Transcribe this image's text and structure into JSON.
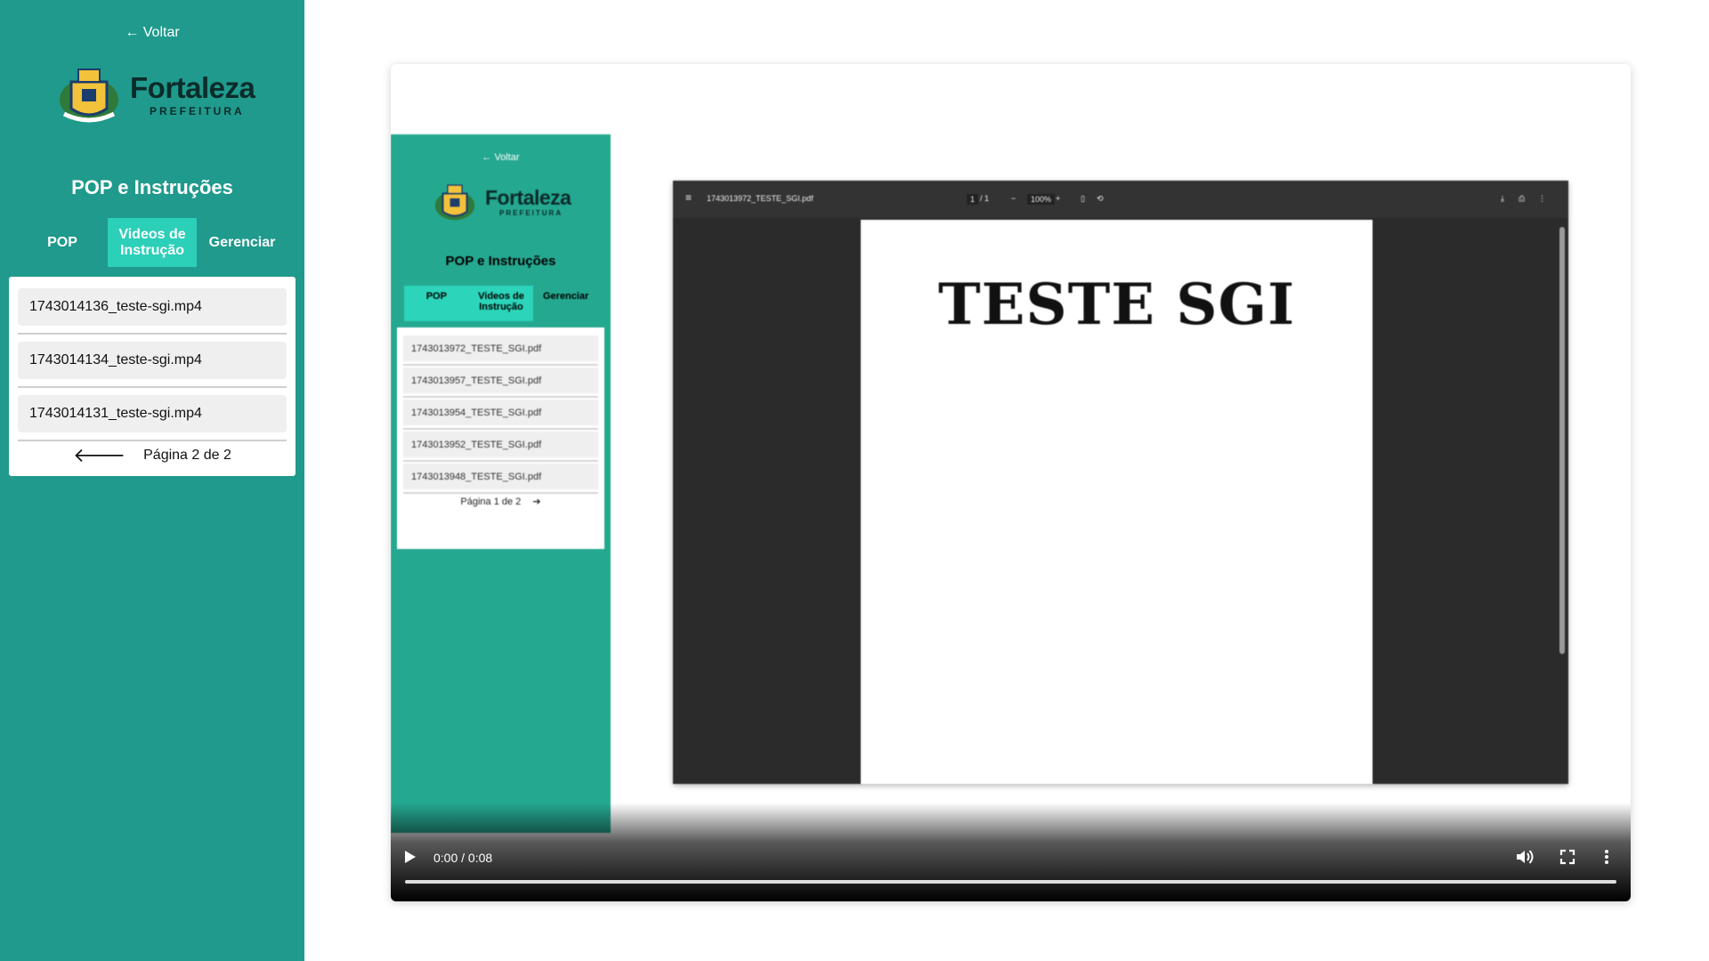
{
  "sidebar": {
    "back_label": "← Voltar",
    "logo_name": "Fortaleza",
    "logo_sub": "PREFEITURA",
    "title": "POP e Instruções",
    "tabs": [
      {
        "label": "POP",
        "active": false
      },
      {
        "label": "Videos de Instrução",
        "active": true
      },
      {
        "label": "Gerenciar",
        "active": false
      }
    ],
    "files": [
      "1743014136_teste-sgi.mp4",
      "1743014134_teste-sgi.mp4",
      "1743014131_teste-sgi.mp4"
    ],
    "pager_prev_icon": "arrow-left-icon",
    "pager_label": "Página 2 de 2"
  },
  "video": {
    "time_label": "0:00 / 0:08",
    "icons": [
      "play-icon",
      "volume-icon",
      "fullscreen-icon",
      "more-options-icon"
    ],
    "frame": {
      "back_label": "← Voltar",
      "logo_name": "Fortaleza",
      "logo_sub": "PREFEITURA",
      "title": "POP e Instruções",
      "tabs": [
        {
          "label": "POP",
          "active": true
        },
        {
          "label": "Videos de Instrução",
          "active": true
        },
        {
          "label": "Gerenciar",
          "active": false
        }
      ],
      "files": [
        "1743013972_TESTE_SGI.pdf",
        "1743013957_TESTE_SGI.pdf",
        "1743013954_TESTE_SGI.pdf",
        "1743013952_TESTE_SGI.pdf",
        "1743013948_TESTE_SGI.pdf"
      ],
      "pager_label": "Página 1 de 2",
      "pdf": {
        "filename": "1743013972_TESTE_SGI.pdf",
        "page_current": "1",
        "page_total": "/ 1",
        "zoom": "100%",
        "doc_heading": "TESTE SGI"
      }
    }
  },
  "colors": {
    "sidebar_bg": "#1f9a8c",
    "active_tab": "#2ccfb8",
    "logo_text": "#0b2b2a"
  }
}
